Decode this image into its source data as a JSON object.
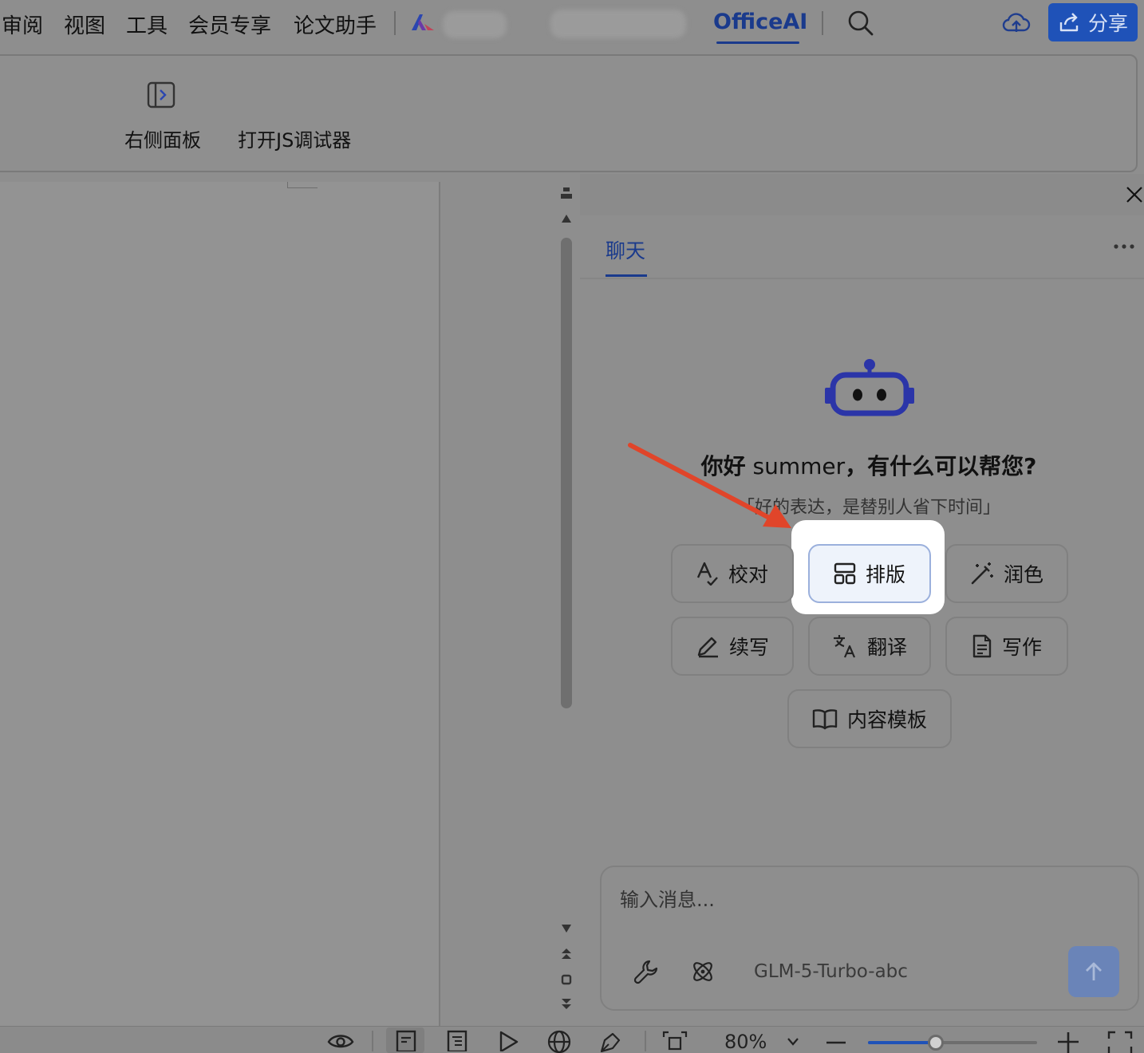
{
  "menu": {
    "items": [
      "审阅",
      "视图",
      "工具",
      "会员专享",
      "论文助手"
    ],
    "active_tab": "OfficeAI",
    "share_label": "分享"
  },
  "ribbon": {
    "right_panel_label": "右侧面板",
    "js_debugger_label": "打开JS调试器"
  },
  "panel": {
    "tab_chat": "聊天",
    "greeting_prefix": "你好",
    "greeting_name": " summer",
    "greeting_suffix": "，有什么可以帮您?",
    "subtitle": "「好的表达，是替别人省下时间」",
    "actions": {
      "proofread": "校对",
      "layout": "排版",
      "polish": "润色",
      "continue": "续写",
      "translate": "翻译",
      "write": "写作",
      "templates": "内容模板"
    },
    "input_placeholder": "输入消息...",
    "model_name": "GLM-5-Turbo-abc"
  },
  "status": {
    "zoom": "80%",
    "zoom_fraction": 0.4
  },
  "colors": {
    "accent": "#1a3a8c",
    "share_bg": "#1f52b8",
    "robot": "#2b35a8",
    "annotation_arrow": "#e0452a"
  }
}
